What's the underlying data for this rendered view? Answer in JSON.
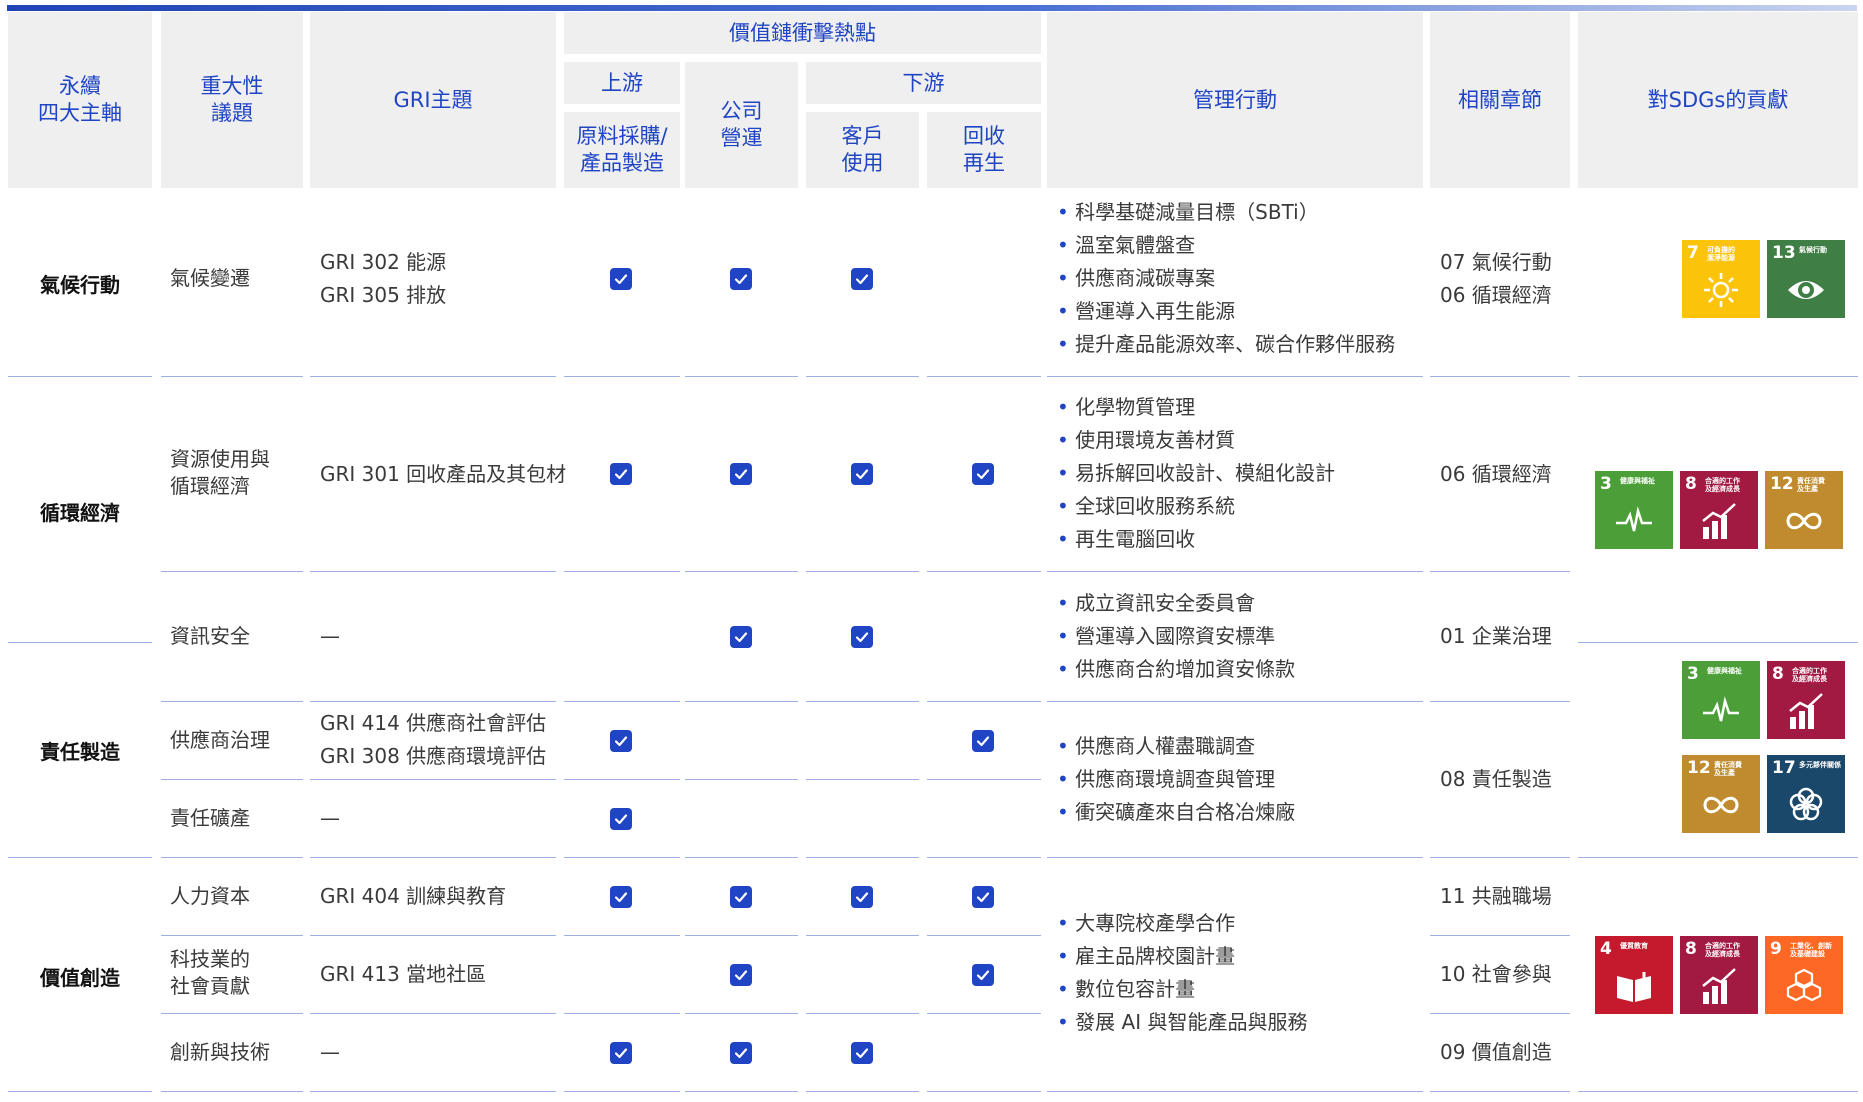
{
  "header": {
    "axis": "永續\n四大主軸",
    "materiality": "重大性\n議題",
    "gri": "GRI主題",
    "value_chain": "價值鏈衝擊熱點",
    "upstream": "上游",
    "company": "公司\n營運",
    "downstream": "下游",
    "raw": "原料採購/\n產品製造",
    "customer": "客戶\n使用",
    "recycle": "回收\n再生",
    "management": "管理行動",
    "chapter": "相關章節",
    "sdg": "對SDGs的貢獻"
  },
  "axes": [
    "氣候行動",
    "循環經濟",
    "責任製造",
    "價值創造"
  ],
  "rows": [
    {
      "topic": "氣候變遷",
      "gri": [
        "GRI 302 能源",
        "GRI 305 排放"
      ],
      "checks": [
        true,
        true,
        true,
        false
      ]
    },
    {
      "topic": "資源使用與\n循環經濟",
      "gri": [
        "GRI 301 回收產品及其包材"
      ],
      "checks": [
        true,
        true,
        true,
        true
      ]
    },
    {
      "topic": "資訊安全",
      "gri": [
        "—"
      ],
      "checks": [
        false,
        true,
        true,
        false
      ]
    },
    {
      "topic": "供應商治理",
      "gri": [
        "GRI 414 供應商社會評估",
        "GRI 308 供應商環境評估"
      ],
      "checks": [
        true,
        false,
        false,
        true
      ]
    },
    {
      "topic": "責任礦產",
      "gri": [
        "—"
      ],
      "checks": [
        true,
        false,
        false,
        false
      ]
    },
    {
      "topic": "人力資本",
      "gri": [
        "GRI 404 訓練與教育"
      ],
      "checks": [
        true,
        true,
        true,
        true
      ]
    },
    {
      "topic": "科技業的\n社會貢獻",
      "gri": [
        "GRI 413 當地社區"
      ],
      "checks": [
        false,
        true,
        false,
        true
      ]
    },
    {
      "topic": "創新與技術",
      "gri": [
        "—"
      ],
      "checks": [
        true,
        true,
        true,
        false
      ]
    }
  ],
  "management": [
    [
      "科學基礎減量目標（SBTi）",
      "溫室氣體盤查",
      "供應商減碳專案",
      "營運導入再生能源",
      "提升產品能源效率、碳合作夥伴服務"
    ],
    [
      "化學物質管理",
      "使用環境友善材質",
      "易拆解回收設計、模組化設計",
      "全球回收服務系統",
      "再生電腦回收"
    ],
    [
      "成立資訊安全委員會",
      "營運導入國際資安標準",
      "供應商合約增加資安條款"
    ],
    [
      "供應商人權盡職調查",
      "供應商環境調查與管理",
      "衝突礦產來自合格冶煉廠"
    ],
    [
      "大專院校產學合作",
      "雇主品牌校園計畫",
      "數位包容計畫",
      "發展 AI 與智能產品與服務"
    ]
  ],
  "chapters": {
    "climate": [
      "07 氣候行動",
      "06 循環經濟"
    ],
    "circular": "06 循環經濟",
    "infosec": "01 企業治理",
    "responsible": "08 責任製造",
    "talent": "11 共融職場",
    "society": "10 社會參與",
    "innovation": "09 價值創造"
  },
  "sdgs": {
    "s7": {
      "num": "7",
      "label": "可負擔的\n潔淨能源",
      "color": "#fcc30b",
      "icon": "sun-icon"
    },
    "s13": {
      "num": "13",
      "label": "氣候行動",
      "color": "#3f7e44",
      "icon": "globe-eye-icon"
    },
    "s3": {
      "num": "3",
      "label": "健康與福祉",
      "color": "#4c9f38",
      "icon": "heartbeat-icon"
    },
    "s8": {
      "num": "8",
      "label": "合適的工作\n及經濟成長",
      "color": "#a21942",
      "icon": "growth-chart-icon"
    },
    "s12": {
      "num": "12",
      "label": "責任消費\n及生產",
      "color": "#bf8b2e",
      "icon": "infinity-icon"
    },
    "s17": {
      "num": "17",
      "label": "多元夥伴關係",
      "color": "#19486a",
      "icon": "flower-icon"
    },
    "s4": {
      "num": "4",
      "label": "優質教育",
      "color": "#c5192d",
      "icon": "book-icon"
    },
    "s9": {
      "num": "9",
      "label": "工業化、創新\n及基礎建設",
      "color": "#fd6925",
      "icon": "cubes-icon"
    }
  }
}
